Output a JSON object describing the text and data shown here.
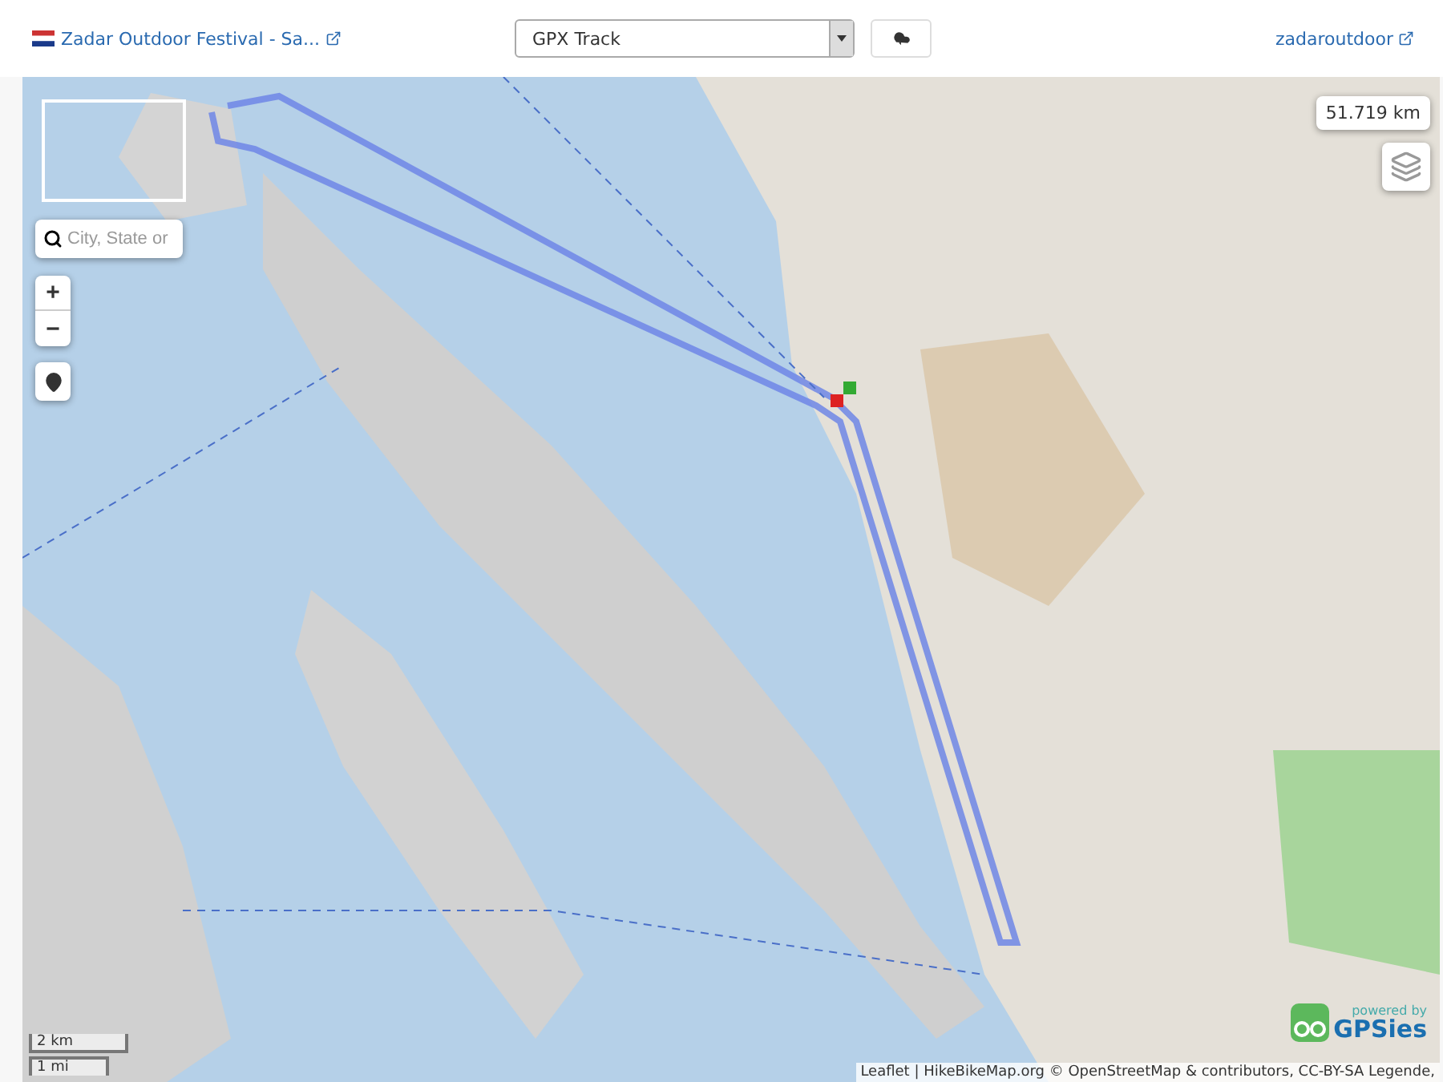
{
  "header": {
    "title": "Zadar Outdoor Festival - Sa...",
    "track_select": {
      "value": "GPX Track"
    },
    "user_link": "zadaroutdoor"
  },
  "map": {
    "search": {
      "placeholder": "City, State or"
    },
    "zoom_in": "+",
    "zoom_out": "−",
    "distance": "51.719 km",
    "scale": [
      "2 km",
      "1 mi"
    ],
    "attribution": "Leaflet | HikeBikeMap.org © OpenStreetMap & contributors, CC-BY-SA Legende,",
    "powered_by": "powered by",
    "brand": "GPSies"
  }
}
